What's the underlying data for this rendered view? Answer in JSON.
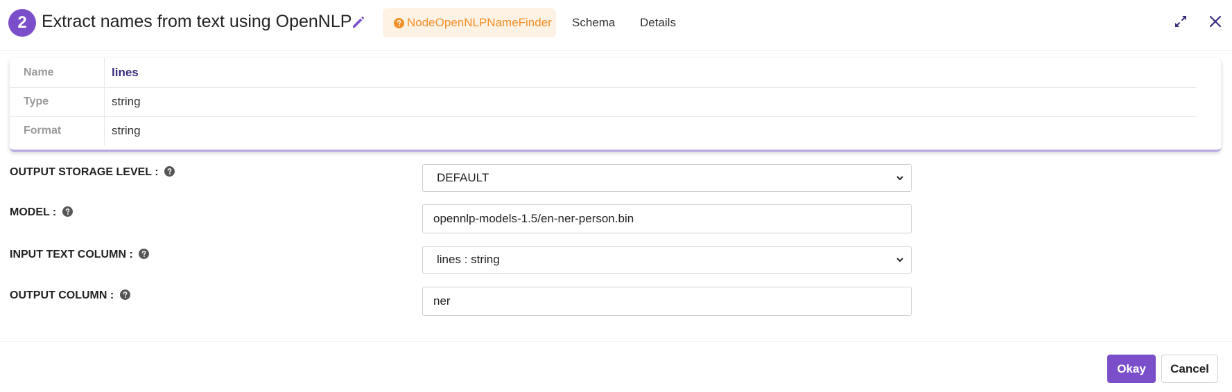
{
  "header": {
    "step_number": "2",
    "title": "Extract names from text using OpenNLP",
    "tabs": [
      {
        "label": "NodeOpenNLPNameFinder",
        "active": true
      },
      {
        "label": "Schema"
      },
      {
        "label": "Details"
      }
    ]
  },
  "schema": {
    "rows": [
      {
        "key": "Name",
        "value": "lines"
      },
      {
        "key": "Type",
        "value": "string"
      },
      {
        "key": "Format",
        "value": "string"
      }
    ]
  },
  "form": {
    "output_storage_level": {
      "label": "OUTPUT STORAGE LEVEL :",
      "value": "DEFAULT"
    },
    "model": {
      "label": "MODEL :",
      "value": "opennlp-models-1.5/en-ner-person.bin"
    },
    "input_text_column": {
      "label": "INPUT TEXT COLUMN :",
      "value": "lines : string"
    },
    "output_column": {
      "label": "OUTPUT COLUMN :",
      "value": "ner"
    }
  },
  "footer": {
    "okay_label": "Okay",
    "cancel_label": "Cancel"
  },
  "colors": {
    "accent": "#7b4fc9",
    "tab_active_bg": "#fdf2e3",
    "tab_active_text": "#f3902a",
    "schema_name": "#3b2c7e"
  },
  "icons": [
    "edit-pencil-icon",
    "question-circle-icon",
    "expand-icon",
    "close-icon",
    "help-icon",
    "chevron-down-icon"
  ]
}
